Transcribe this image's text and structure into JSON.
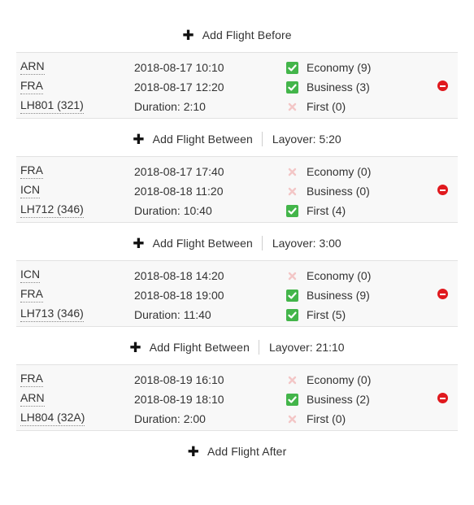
{
  "add_before": {
    "icon": "plus-icon",
    "label": "Add Flight Before"
  },
  "add_after": {
    "icon": "plus-icon",
    "label": "Add Flight After"
  },
  "between": [
    {
      "label": "Add Flight Between",
      "layover": "Layover: 5:20"
    },
    {
      "label": "Add Flight Between",
      "layover": "Layover: 3:00"
    },
    {
      "label": "Add Flight Between",
      "layover": "Layover: 21:10"
    }
  ],
  "colors": {
    "check": "#43b54a",
    "cross": "#f3c6c6",
    "remove": "#e0191e",
    "block_bg": "#f8f8f8"
  },
  "flights": [
    {
      "from": "ARN",
      "to": "FRA",
      "flight": "LH801 (321)",
      "depart": "2018-08-17 10:10",
      "arrive": "2018-08-17 12:20",
      "duration": "Duration: 2:10",
      "classes": [
        {
          "available": true,
          "label": "Economy (9)"
        },
        {
          "available": true,
          "label": "Business (3)"
        },
        {
          "available": false,
          "label": "First (0)"
        }
      ]
    },
    {
      "from": "FRA",
      "to": "ICN",
      "flight": "LH712 (346)",
      "depart": "2018-08-17 17:40",
      "arrive": "2018-08-18 11:20",
      "duration": "Duration: 10:40",
      "classes": [
        {
          "available": false,
          "label": "Economy (0)"
        },
        {
          "available": false,
          "label": "Business (0)"
        },
        {
          "available": true,
          "label": "First (4)"
        }
      ]
    },
    {
      "from": "ICN",
      "to": "FRA",
      "flight": "LH713 (346)",
      "depart": "2018-08-18 14:20",
      "arrive": "2018-08-18 19:00",
      "duration": "Duration: 11:40",
      "classes": [
        {
          "available": false,
          "label": "Economy (0)"
        },
        {
          "available": true,
          "label": "Business (9)"
        },
        {
          "available": true,
          "label": "First (5)"
        }
      ]
    },
    {
      "from": "FRA",
      "to": "ARN",
      "flight": "LH804 (32A)",
      "depart": "2018-08-19 16:10",
      "arrive": "2018-08-19 18:10",
      "duration": "Duration: 2:00",
      "classes": [
        {
          "available": false,
          "label": "Economy (0)"
        },
        {
          "available": true,
          "label": "Business (2)"
        },
        {
          "available": false,
          "label": "First (0)"
        }
      ]
    }
  ]
}
